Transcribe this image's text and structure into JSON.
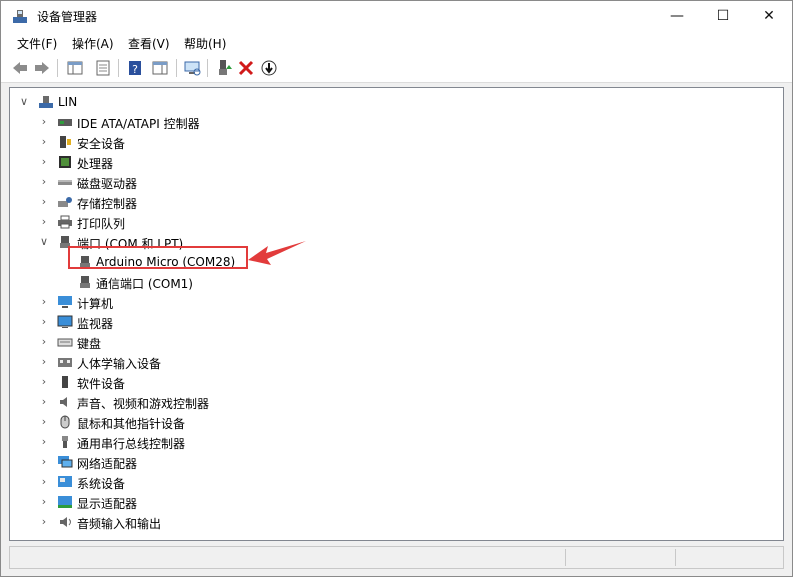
{
  "window": {
    "title": "设备管理器"
  },
  "window_buttons": {
    "minimize": "—",
    "maximize": "☐",
    "close": "✕"
  },
  "menu": [
    {
      "label": "文件(F)"
    },
    {
      "label": "操作(A)"
    },
    {
      "label": "查看(V)"
    },
    {
      "label": "帮助(H)"
    }
  ],
  "tree": {
    "root": "LIN",
    "categories": [
      {
        "label": "IDE ATA/ATAPI 控制器",
        "icon": "ide-controller-icon"
      },
      {
        "label": "安全设备",
        "icon": "security-device-icon"
      },
      {
        "label": "处理器",
        "icon": "processor-icon"
      },
      {
        "label": "磁盘驱动器",
        "icon": "disk-drive-icon"
      },
      {
        "label": "存储控制器",
        "icon": "storage-controller-icon"
      },
      {
        "label": "打印队列",
        "icon": "print-queue-icon"
      },
      {
        "label": "端口 (COM 和 LPT)",
        "icon": "port-icon",
        "expanded": true,
        "children": [
          {
            "label": "Arduino Micro (COM28)",
            "highlighted": true
          },
          {
            "label": "通信端口 (COM1)"
          }
        ]
      },
      {
        "label": "计算机",
        "icon": "computer-icon"
      },
      {
        "label": "监视器",
        "icon": "monitor-icon"
      },
      {
        "label": "键盘",
        "icon": "keyboard-icon"
      },
      {
        "label": "人体学输入设备",
        "icon": "hid-icon"
      },
      {
        "label": "软件设备",
        "icon": "software-device-icon"
      },
      {
        "label": "声音、视频和游戏控制器",
        "icon": "sound-icon"
      },
      {
        "label": "鼠标和其他指针设备",
        "icon": "mouse-icon"
      },
      {
        "label": "通用串行总线控制器",
        "icon": "usb-icon"
      },
      {
        "label": "网络适配器",
        "icon": "network-adapter-icon"
      },
      {
        "label": "系统设备",
        "icon": "system-device-icon"
      },
      {
        "label": "显示适配器",
        "icon": "display-adapter-icon"
      },
      {
        "label": "音频输入和输出",
        "icon": "audio-io-icon"
      }
    ]
  },
  "colors": {
    "highlight_border": "#e23b3b",
    "arrow": "#e23b3b"
  }
}
